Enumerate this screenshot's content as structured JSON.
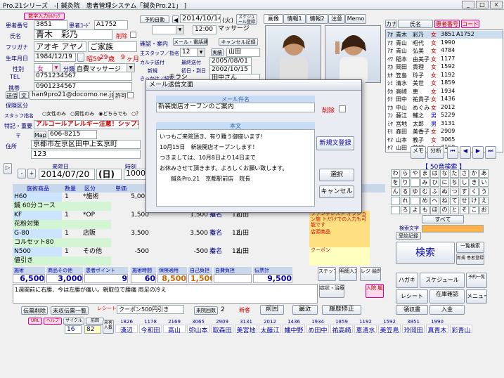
{
  "title_bar": {
    "text": "Pro.21シリーズ　-[ 鍼灸院　患者管理システム「鍼灸Pro.21」 ]",
    "btn_min": "_",
    "btn_max": "□",
    "btn_close": "×"
  },
  "patient": {
    "input_btn": "数字入力ｶﾙﾃｯｸ",
    "patient_no_label": "患者番号",
    "patient_no": "3851",
    "patient_code_label": "患者ｺｰﾄﾞ",
    "patient_code": "A1752",
    "delete_label": "削除",
    "name_label": "氏名",
    "name": "青木　彩乃",
    "furigana_label": "フリガナ",
    "furigana": "アオキ アヤノ",
    "family": "ご家族",
    "dob_label": "生年月日",
    "dob": "1984/12/19",
    "era": "昭59",
    "age": "29",
    "age_unit": "歳",
    "months": "9",
    "months_unit": "ヶ月",
    "sex_label": "性別",
    "sex": "女",
    "category_label": "分類",
    "category": "自費マッサージ",
    "tel_label": "TEL",
    "tel": "0751234567",
    "mobile_label": "携帯",
    "mobile": "0901234567",
    "mail_label": "Mail",
    "mail": "han9pro21@docomo.ne.jp",
    "mail_btn": "送信",
    "mail_doc": "文",
    "permit": "許可",
    "insurance_label": "保険区分",
    "staff_label": "スタッフ指名",
    "staff_opts": [
      "女性のみ",
      "男性のみ",
      "どちらでも",
      "？"
    ],
    "special_label": "特記・重要",
    "special": "アルコールアレルギー注意！シップなど",
    "zip_label": "〒",
    "map_btn": "Map",
    "zip": "606-8215",
    "address_label": "住所",
    "address1": "京都市左京区田中上玄京町",
    "address2": "123"
  },
  "schedule": {
    "reserve_btn": "予約自動",
    "date": "2014/10/14",
    "weekday": "(火)",
    "schedule_btn": "スケジュール登録",
    "time": "12:00",
    "course": "マッサージ",
    "confirm_label": "確認・案内",
    "mailinfo": "メール・電話連絡",
    "cancel_btn": "キャンセル記録",
    "staff_label": "主スタッフ／指名",
    "staff_count": "12",
    "lab": "実績",
    "staff": "山田",
    "karte_label": "カルテ送付",
    "last_visit_label": "最終送付",
    "last_visit": "2005/08/01",
    "new_label": "新規",
    "first_visit_label": "初日・到日",
    "first_visit": "2002/10/15",
    "intro_label": "きっかけ／紹介",
    "intro": "チラシ",
    "intro2": "田中さん"
  },
  "photo_tabs": [
    "画像",
    "情報1",
    "情報2",
    "注意",
    "Memo"
  ],
  "patient_list": {
    "tabs": [
      "カナ",
      "氏名",
      "患者番号",
      "コード"
    ],
    "rows": [
      {
        "kana": "ｱｵ",
        "name": "青木　彩乃",
        "sex": "女",
        "no": "3851",
        "code": "A1752"
      },
      {
        "kana": "ｱｵ",
        "name": "青山　昭代",
        "sex": "女",
        "no": "1990",
        "code": ""
      },
      {
        "kana": "ｱｵ",
        "name": "青山　弘美",
        "sex": "女",
        "no": "4784",
        "code": ""
      },
      {
        "kana": "ｲﾜ",
        "name": "稲本　由美子",
        "sex": "女",
        "no": "1177",
        "code": ""
      },
      {
        "kana": "ｵｶ",
        "name": "岡田　貴理",
        "sex": "女",
        "no": "1592",
        "code": ""
      },
      {
        "kana": "ｶｻ",
        "name": "笠島　玲子",
        "sex": "女",
        "no": "1192",
        "code": ""
      },
      {
        "kana": "ｼﾐ",
        "name": "清水　美世",
        "女": "",
        "sex": "女",
        "no": "1859",
        "code": ""
      },
      {
        "kana": "ﾀｶ",
        "name": "高崎　恵",
        "sex": "女",
        "no": "1934",
        "code": ""
      },
      {
        "kana": "ﾀﾅ",
        "name": "田中　祐貴子",
        "sex": "女",
        "no": "1436",
        "code": ""
      },
      {
        "kana": "ﾅｶ",
        "name": "中山　めぐみ",
        "sex": "女",
        "no": "2012",
        "code": ""
      },
      {
        "kana": "ﾌｼ",
        "name": "藤江　輔之",
        "sex": "男",
        "no": "5229",
        "code": ""
      },
      {
        "kana": "ﾐﾔ",
        "name": "宮地　太郎",
        "sex": "男",
        "no": "3131",
        "code": ""
      },
      {
        "kana": "ﾓﾘ",
        "name": "森田　美香子",
        "sex": "女",
        "no": "2909",
        "code": ""
      },
      {
        "kana": "ﾔﾏ",
        "name": "山本　教子",
        "sex": "女",
        "no": "3065",
        "code": ""
      },
      {
        "kana": "ﾔﾏ",
        "name": "山田　美穂",
        "sex": "女",
        "no": "3169",
        "code": ""
      }
    ]
  },
  "right_controls": {
    "memo": "メモ",
    "analyze": "分析",
    "kana_title": "【 50音検索 】",
    "all": "すべて",
    "kana": [
      "わ",
      "ら",
      "や",
      "ま",
      "は",
      "な",
      "た",
      "さ",
      "か",
      "あ",
      "を",
      "り",
      "",
      "み",
      "ひ",
      "に",
      "ち",
      "し",
      "き",
      "い",
      "ん",
      "る",
      "ゆ",
      "む",
      "ふ",
      "ぬ",
      "つ",
      "す",
      "く",
      "う",
      "",
      "れ",
      "",
      "め",
      "へ",
      "ね",
      "て",
      "せ",
      "け",
      "え",
      "",
      "ろ",
      "よ",
      "も",
      "ほ",
      "の",
      "と",
      "そ",
      "こ",
      "お"
    ],
    "patient_text_label": "検索文字",
    "visit_label": "受診記録",
    "search": "検索",
    "multi_search": "一覧検索",
    "new_search": "新規 患者登録",
    "hagaki": "ハガキ",
    "schedule": "スケジュール",
    "receipt": "レシート",
    "inquiry": "在庫確認",
    "daily": "日報",
    "monthly": "月報",
    "menu": "メニュー",
    "report": "領収書",
    "accounting": "入金",
    "prev_list": "予約一覧"
  },
  "visit": {
    "visit_date_label": "来院日",
    "visit_date": "2014/07/20",
    "visit_wd": "(日)",
    "time_label": "時刻",
    "time": "1000",
    "col_headers": [
      "施術商品",
      "数量",
      "区分",
      "単価",
      "",
      "",
      "",
      "指名",
      "担当",
      "",
      "メモ"
    ],
    "rows": [
      {
        "code": "H60",
        "qty": "1",
        "div": "*施術",
        "price": "5,000",
        "amount": "",
        "name": "",
        "staff": "",
        "note": ""
      },
      {
        "code": "鍼 60分コース",
        "qty": "",
        "div": "",
        "price": "",
        "amount": "",
        "name": "",
        "staff": "",
        "note": ""
      },
      {
        "code": "KF",
        "qty": "1",
        "div": "*OP",
        "price": "1,500",
        "amount": "1,500",
        "x": "0",
        "y": "12",
        "sign": "指名",
        "staff": "山田",
        "note": "ファンデレスト オプション施 トだけでの入力も可能です"
      },
      {
        "code": "花粉対策",
        "qty": "",
        "div": "",
        "price": "",
        "amount": "",
        "name": "",
        "staff": "",
        "note": ""
      },
      {
        "code": "G-80",
        "qty": "1",
        "div": "店販",
        "price": "3,500",
        "amount": "3,500",
        "x": "0",
        "y": "12",
        "sign": "指名",
        "staff": "山田",
        "note": "店頭商品"
      },
      {
        "code": "コルセット80",
        "qty": "",
        "div": "",
        "price": "",
        "amount": "",
        "name": "",
        "staff": "",
        "note": ""
      },
      {
        "code": "N500",
        "qty": "1",
        "div": "その他",
        "price": "-500",
        "amount": "-500",
        "x": "0",
        "y": "12",
        "sign": "指名",
        "staff": "山田",
        "note": "クーポン"
      },
      {
        "code": "値引き",
        "qty": "",
        "div": "",
        "price": "",
        "amount": "",
        "name": "",
        "staff": "",
        "note": ""
      }
    ],
    "totals_headers": [
      "施術",
      "商品その他",
      "患者ポイント",
      "施術時間",
      "保険適用",
      "自己負担",
      "自費負担",
      "伝票計"
    ],
    "totals": [
      "6,500",
      "3,000",
      "9",
      "60",
      "8,500",
      "1,500",
      "",
      "9,500"
    ],
    "memo": "1週間前に右腰、今は左腰が痛い。親取位で腰痛 両足の冷え",
    "step_btn": "ステップ",
    "detail_btn": "明細入力",
    "reg_btn": "レジ 絵的り",
    "symptom_btn": "症状・治療 入力",
    "input_history": "入院 履歴",
    "slip_btn": "伝票削除",
    "unsettled": "未収伝票一覧",
    "receipt_msg": "レシート メモ",
    "coupon": "クーポン500円引き",
    "visit_count_label": "来院回数",
    "visit_count": "2",
    "new_label": "新客",
    "prev": "前回",
    "latest": "最近",
    "history_fix": "履歴修正"
  },
  "modal": {
    "title": "メール送信文面",
    "subject_label": "メール件名",
    "subject": "新装開店オープンのご案内",
    "delete": "削除",
    "body_label": "本文",
    "body": [
      "いつもご来院頂き、有り難う御座います!",
      "10月15日　新装開店オープンします！",
      "つきましては、10月8日より14日まで",
      "お休みさせて頂きます。よろしくお願い致します。",
      "　　鍼灸Pro.21　京都駅前店　院長"
    ],
    "new_template": "新規文登録",
    "select": "選択",
    "cancel": "キャンセル"
  },
  "bottom": {
    "tabs": [
      "URL",
      "ヘルプ",
      "サイクル",
      "前回"
    ],
    "sparks": [
      {
        "no": "1826",
        "name": "漢辺"
      },
      {
        "no": "1178",
        "name": "今和田"
      },
      {
        "no": "2169",
        "name": "高山"
      },
      {
        "no": "3065",
        "name": "弥山本"
      },
      {
        "no": "2909",
        "name": "取森田"
      },
      {
        "no": "3131",
        "name": "美宮地"
      },
      {
        "no": "2012",
        "name": "太藤江"
      },
      {
        "no": "1436",
        "name": "幡中野"
      },
      {
        "no": "1934",
        "name": "め田中"
      },
      {
        "no": "1859",
        "name": "祐高崎"
      },
      {
        "no": "1192",
        "name": "恵清水"
      },
      {
        "no": "1592",
        "name": "美笠島"
      },
      {
        "no": "3851",
        "name": "玲岡田"
      },
      {
        "no": "1990",
        "name": "真青木"
      },
      {
        "no": "",
        "name": "彩青山"
      }
    ],
    "count1": "16",
    "count2": "82",
    "visit_list": "来客 人数"
  }
}
